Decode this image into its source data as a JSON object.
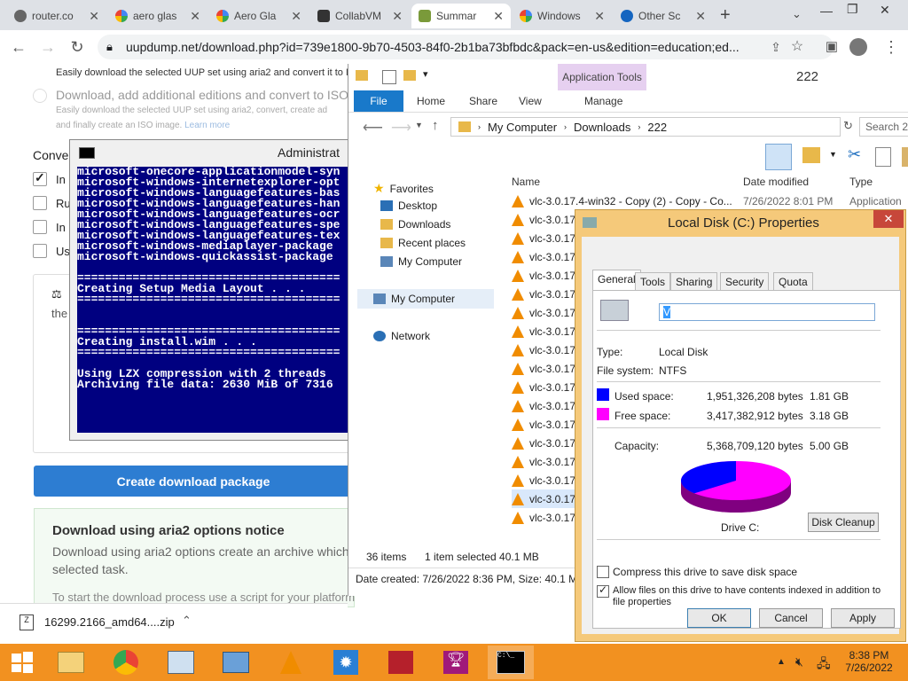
{
  "browser": {
    "tabs": [
      {
        "label": "router.co",
        "active": false
      },
      {
        "label": "aero glas",
        "active": false
      },
      {
        "label": "Aero Gla",
        "active": false
      },
      {
        "label": "CollabVM",
        "active": false
      },
      {
        "label": "Summar",
        "active": true
      },
      {
        "label": "Windows",
        "active": false
      },
      {
        "label": "Other Sc",
        "active": false
      }
    ],
    "url": "uupdump.net/download.php?id=739e1800-9b70-4503-84f0-2b1ba73bfbdc&pack=en-us&edition=education;ed..."
  },
  "webpage": {
    "opt1_desc": "Easily download the selected UUP set using aria2 and convert it to IS",
    "opt2_title": "Download, add additional editions and convert to ISO",
    "opt2_desc1": "Easily download the selected UUP set using aria2, convert, create ad",
    "opt2_desc2": "and finally create an ISO image.",
    "learn_more": "Learn more",
    "conversion_label": "Conver",
    "options": [
      "In",
      "Ru",
      "In",
      "Us"
    ],
    "license_text": "the",
    "create_button": "Create download package",
    "notice_title": "Download using aria2 options notice",
    "notice_text1": "Download using aria2 options create an archive which r",
    "notice_text2": "selected task.",
    "notice_text3": "To start the download process use a script for your platform"
  },
  "cmd": {
    "title": "Administrat",
    "lines": [
      "microsoft-onecore-applicationmodel-syn",
      "microsoft-windows-internetexplorer-opt",
      "microsoft-windows-languagefeatures-bas",
      "microsoft-windows-languagefeatures-han",
      "microsoft-windows-languagefeatures-ocr",
      "microsoft-windows-languagefeatures-spe",
      "microsoft-windows-languagefeatures-tex",
      "microsoft-windows-mediaplayer-package",
      "microsoft-windows-quickassist-package",
      "",
      "======================================",
      "Creating Setup Media Layout . . .",
      "======================================",
      "",
      "",
      "======================================",
      "Creating install.wim . . .",
      "======================================",
      "",
      "Using LZX compression with 2 threads",
      "Archiving file data: 2630 MiB of 7316"
    ]
  },
  "explorer": {
    "title": "222",
    "context_tab": "Application Tools",
    "ribbon_tabs": [
      "File",
      "Home",
      "Share",
      "View",
      "Manage"
    ],
    "breadcrumb": [
      "My Computer",
      "Downloads",
      "222"
    ],
    "search_placeholder": "Search 22",
    "nav": {
      "favorites": "Favorites",
      "desktop": "Desktop",
      "downloads": "Downloads",
      "recent": "Recent places",
      "my_computer_fav": "My Computer",
      "my_computer": "My Computer",
      "network": "Network"
    },
    "columns": {
      "name": "Name",
      "date": "Date modified",
      "type": "Type"
    },
    "first_file": {
      "name": "vlc-3.0.17.4-win32 - Copy (2) - Copy - Co...",
      "date": "7/26/2022 8:01 PM",
      "type": "Application"
    },
    "file_prefix": "vlc-3.0.17",
    "status_items": "36 items",
    "status_selected": "1 item selected  40.1 MB",
    "details_bar": "Date created: 7/26/2022 8:36 PM, Size: 40.1 MB"
  },
  "properties": {
    "title": "Local Disk (C:) Properties",
    "tabs": [
      "General",
      "Tools",
      "Sharing",
      "Security",
      "Quota"
    ],
    "volume_name": "V",
    "type_label": "Type:",
    "type_value": "Local Disk",
    "fs_label": "File system:",
    "fs_value": "NTFS",
    "used_label": "Used space:",
    "used_bytes": "1,951,326,208 bytes",
    "used_gb": "1.81 GB",
    "free_label": "Free space:",
    "free_bytes": "3,417,382,912 bytes",
    "free_gb": "3.18 GB",
    "capacity_label": "Capacity:",
    "capacity_bytes": "5,368,709,120 bytes",
    "capacity_gb": "5.00 GB",
    "drive_label": "Drive C:",
    "disk_cleanup": "Disk Cleanup",
    "compress_label": "Compress this drive to save disk space",
    "index_label1": "Allow files on this drive to have contents indexed in addition to",
    "index_label2": "file properties",
    "compress_checked": false,
    "index_checked": true,
    "used_fraction": 0.363,
    "colors": {
      "used": "#0000ff",
      "free": "#ff00ff"
    },
    "ok": "OK",
    "cancel": "Cancel",
    "apply": "Apply"
  },
  "download_bar": {
    "filename": "16299.2166_amd64....zip"
  },
  "taskbar": {
    "time": "8:38 PM",
    "date": "7/26/2022",
    "icons": [
      "file-explorer-icon",
      "chrome-icon",
      "task-manager-icon",
      "control-panel-icon",
      "vlc-icon",
      "settings-icon",
      "news-icon",
      "trophy-icon",
      "cmd-icon"
    ]
  }
}
